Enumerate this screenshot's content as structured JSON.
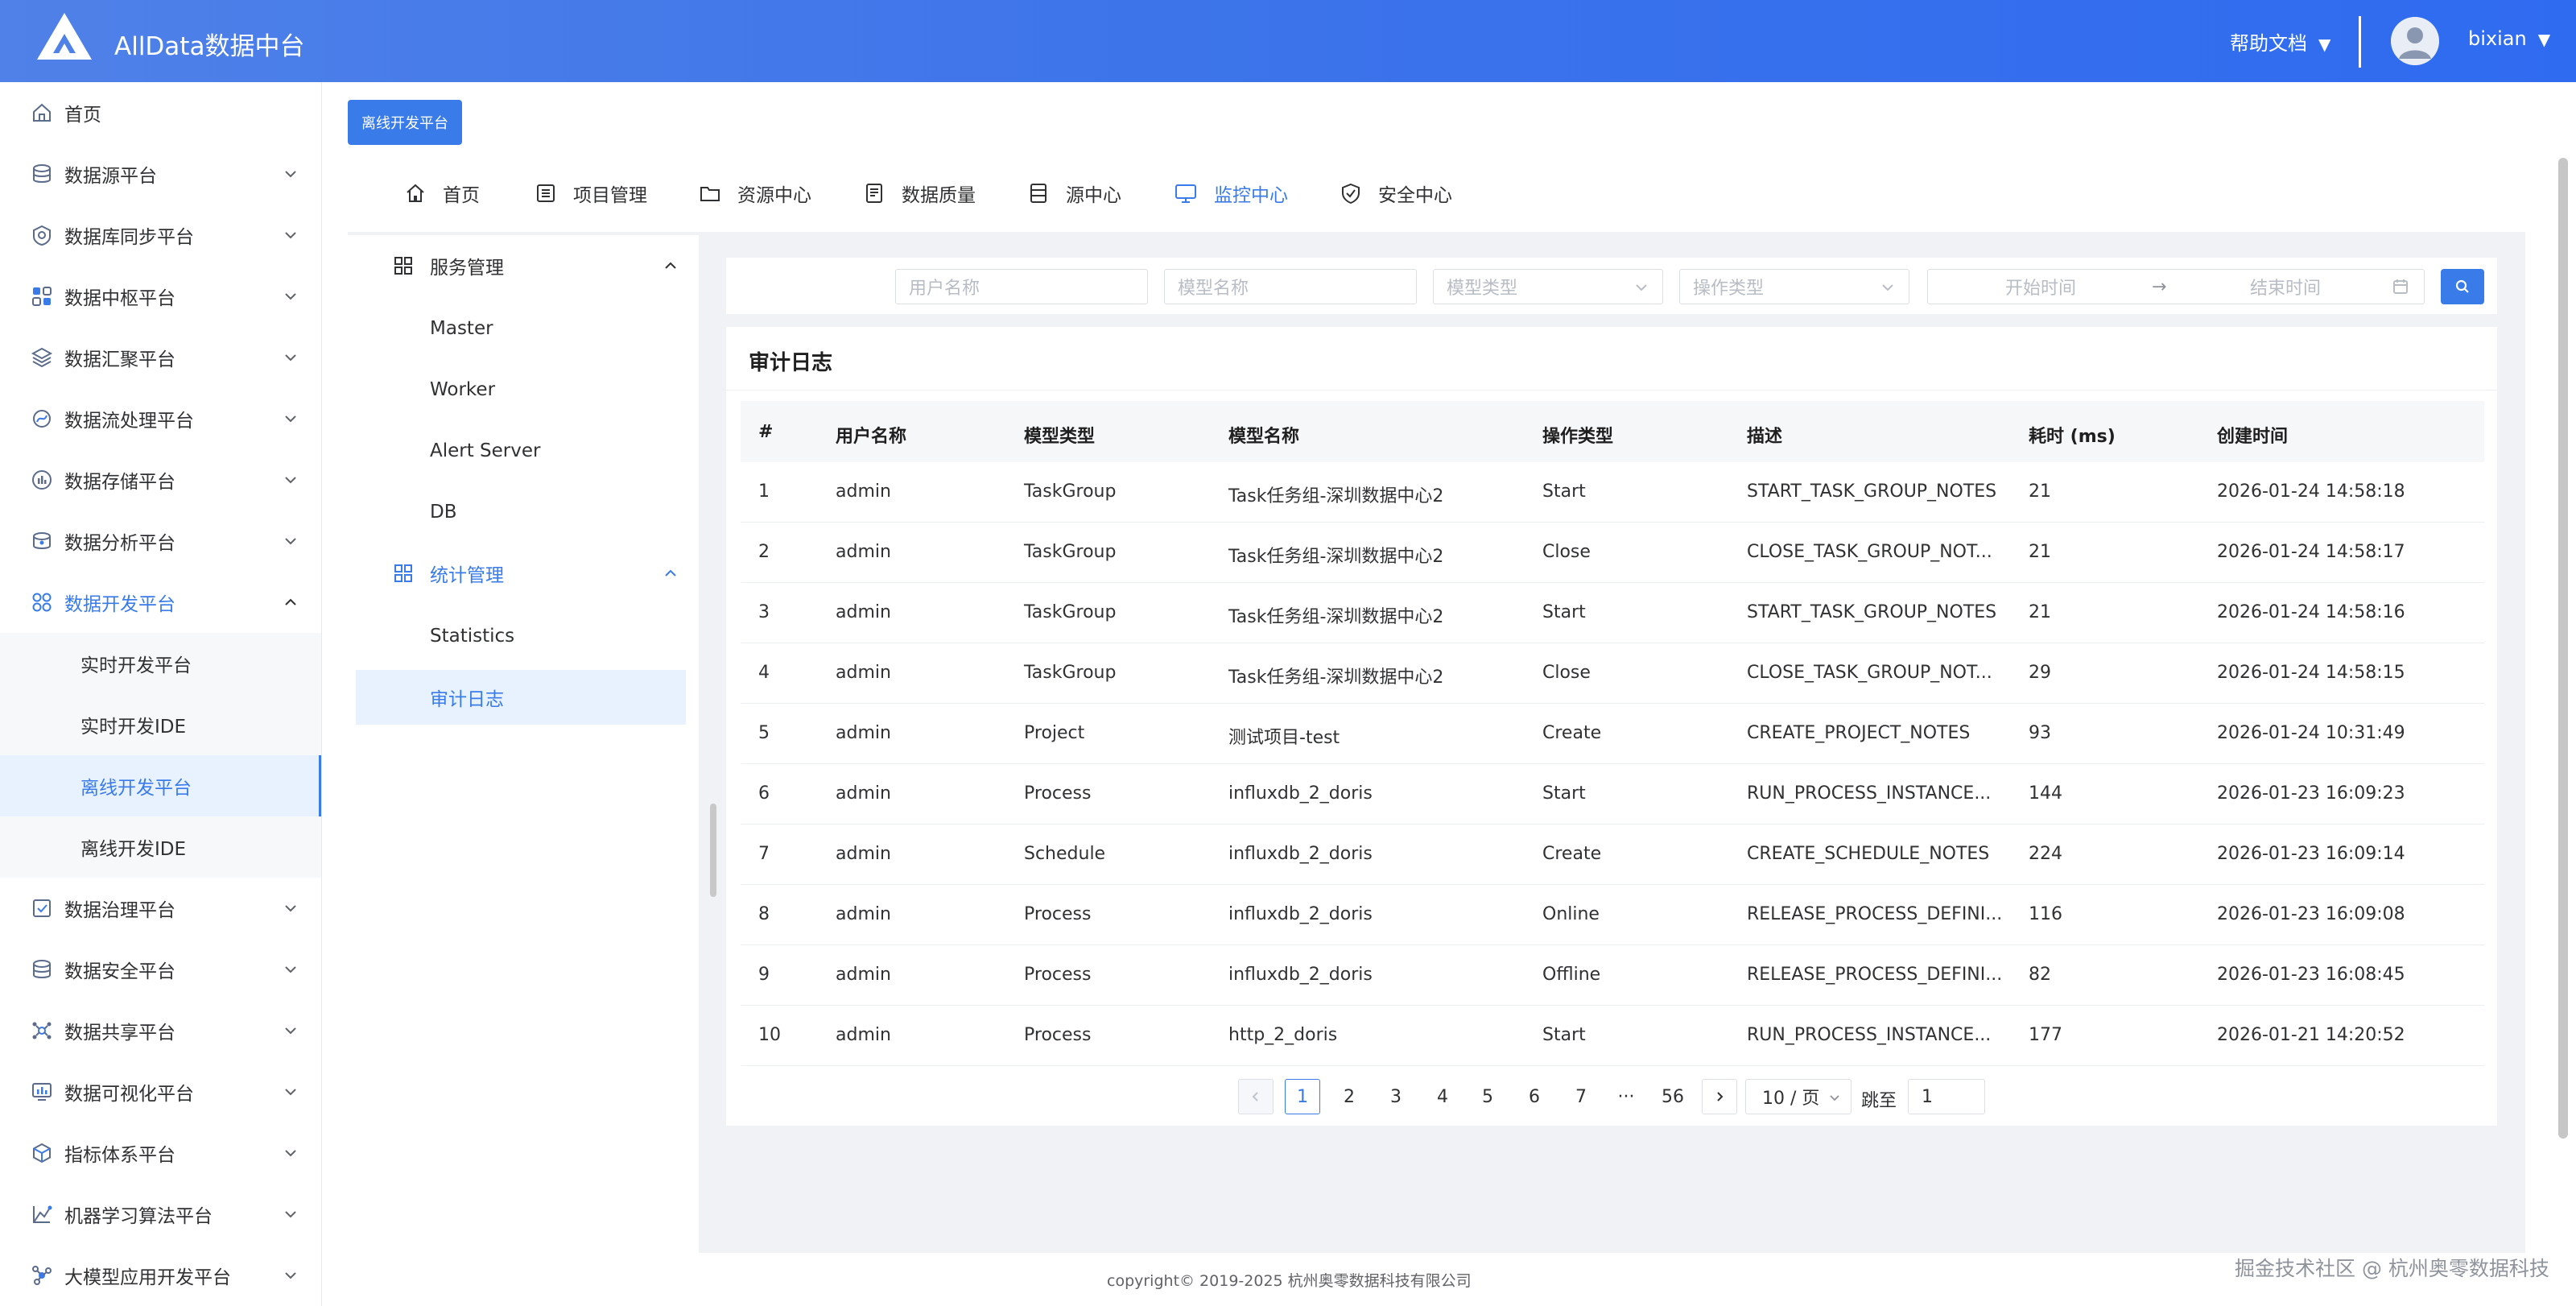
{
  "header": {
    "app_title": "AllData数据中台",
    "help_label": "帮助文档",
    "user_name": "bixian",
    "caret": "▼",
    "brand_color": "#3d74ea"
  },
  "sidebar": {
    "items": [
      {
        "label": "首页",
        "icon": "home-icon"
      },
      {
        "label": "数据源平台",
        "icon": "database-icon"
      },
      {
        "label": "数据库同步平台",
        "icon": "sync-icon"
      },
      {
        "label": "数据中枢平台",
        "icon": "hub-icon"
      },
      {
        "label": "数据汇聚平台",
        "icon": "layers-icon"
      },
      {
        "label": "数据流处理平台",
        "icon": "stream-icon"
      },
      {
        "label": "数据存储平台",
        "icon": "storage-icon"
      },
      {
        "label": "数据分析平台",
        "icon": "analysis-icon"
      },
      {
        "label": "数据开发平台",
        "icon": "dev-icon"
      },
      {
        "label": "数据治理平台",
        "icon": "governance-icon"
      },
      {
        "label": "数据安全平台",
        "icon": "security-icon"
      },
      {
        "label": "数据共享平台",
        "icon": "share-icon"
      },
      {
        "label": "数据可视化平台",
        "icon": "visual-icon"
      },
      {
        "label": "指标体系平台",
        "icon": "metric-icon"
      },
      {
        "label": "机器学习算法平台",
        "icon": "ml-icon"
      },
      {
        "label": "大模型应用开发平台",
        "icon": "llm-icon"
      }
    ],
    "dev_children": [
      "实时开发平台",
      "实时开发IDE",
      "离线开发平台",
      "离线开发IDE"
    ]
  },
  "page_badge": "离线开发平台",
  "topnav": [
    "首页",
    "项目管理",
    "资源中心",
    "数据质量",
    "源中心",
    "监控中心",
    "安全中心"
  ],
  "tree": {
    "group1": "服务管理",
    "group1_items": [
      "Master",
      "Worker",
      "Alert Server",
      "DB"
    ],
    "group2": "统计管理",
    "group2_items": [
      "Statistics",
      "审计日志"
    ]
  },
  "filters": {
    "user_placeholder": "用户名称",
    "model_name_placeholder": "模型名称",
    "model_type_placeholder": "模型类型",
    "op_type_placeholder": "操作类型",
    "start_placeholder": "开始时间",
    "end_placeholder": "结束时间",
    "arrow": "→"
  },
  "table": {
    "title": "审计日志",
    "columns": [
      "#",
      "用户名称",
      "模型类型",
      "模型名称",
      "操作类型",
      "描述",
      "耗时 (ms)",
      "创建时间"
    ],
    "rows": [
      [
        "1",
        "admin",
        "TaskGroup",
        "Task任务组-深圳数据中心2",
        "Start",
        "START_TASK_GROUP_NOTES",
        "21",
        "2026-01-24 14:58:18"
      ],
      [
        "2",
        "admin",
        "TaskGroup",
        "Task任务组-深圳数据中心2",
        "Close",
        "CLOSE_TASK_GROUP_NOT...",
        "21",
        "2026-01-24 14:58:17"
      ],
      [
        "3",
        "admin",
        "TaskGroup",
        "Task任务组-深圳数据中心2",
        "Start",
        "START_TASK_GROUP_NOTES",
        "21",
        "2026-01-24 14:58:16"
      ],
      [
        "4",
        "admin",
        "TaskGroup",
        "Task任务组-深圳数据中心2",
        "Close",
        "CLOSE_TASK_GROUP_NOT...",
        "29",
        "2026-01-24 14:58:15"
      ],
      [
        "5",
        "admin",
        "Project",
        "测试项目-test",
        "Create",
        "CREATE_PROJECT_NOTES",
        "93",
        "2026-01-24 10:31:49"
      ],
      [
        "6",
        "admin",
        "Process",
        "influxdb_2_doris",
        "Start",
        "RUN_PROCESS_INSTANCE...",
        "144",
        "2026-01-23 16:09:23"
      ],
      [
        "7",
        "admin",
        "Schedule",
        "influxdb_2_doris",
        "Create",
        "CREATE_SCHEDULE_NOTES",
        "224",
        "2026-01-23 16:09:14"
      ],
      [
        "8",
        "admin",
        "Process",
        "influxdb_2_doris",
        "Online",
        "RELEASE_PROCESS_DEFINI...",
        "116",
        "2026-01-23 16:09:08"
      ],
      [
        "9",
        "admin",
        "Process",
        "influxdb_2_doris",
        "Offline",
        "RELEASE_PROCESS_DEFINI...",
        "82",
        "2026-01-23 16:08:45"
      ],
      [
        "10",
        "admin",
        "Process",
        "http_2_doris",
        "Start",
        "RUN_PROCESS_INSTANCE...",
        "177",
        "2026-01-21 14:20:52"
      ]
    ]
  },
  "pagination": {
    "pages": [
      "1",
      "2",
      "3",
      "4",
      "5",
      "6",
      "7",
      "···",
      "56"
    ],
    "current": "1",
    "page_size": "10 / 页",
    "jump_label": "跳至",
    "jump_value": "1"
  },
  "footer": "copyright© 2019-2025 杭州奥零数据科技有限公司",
  "watermark": "掘金技术社区 @ 杭州奥零数据科技"
}
